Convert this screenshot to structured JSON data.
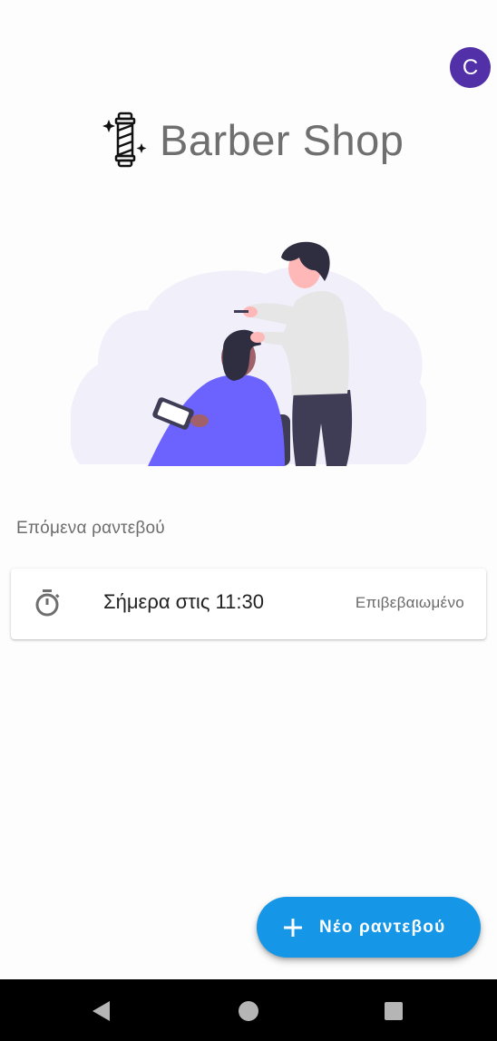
{
  "user": {
    "avatar_letter": "C"
  },
  "brand": {
    "title": "Barber Shop",
    "logo_icon": "barber-pole-icon"
  },
  "appointments": {
    "section_label": "Επόμενα ραντεβού",
    "items": [
      {
        "icon": "stopwatch-icon",
        "time": "Σήμερα στις 11:30",
        "status": "Επιβεβαιωμένο"
      }
    ]
  },
  "fab": {
    "icon": "plus-icon",
    "label": "Νέο ραντεβού"
  },
  "navbar": {
    "back_icon": "back-icon",
    "home_icon": "home-icon",
    "recents_icon": "recents-icon"
  },
  "colors": {
    "accent": "#1596e6",
    "avatar": "#5230a8",
    "illustration_primary": "#6c63ff",
    "illustration_bg": "#f0effa"
  }
}
